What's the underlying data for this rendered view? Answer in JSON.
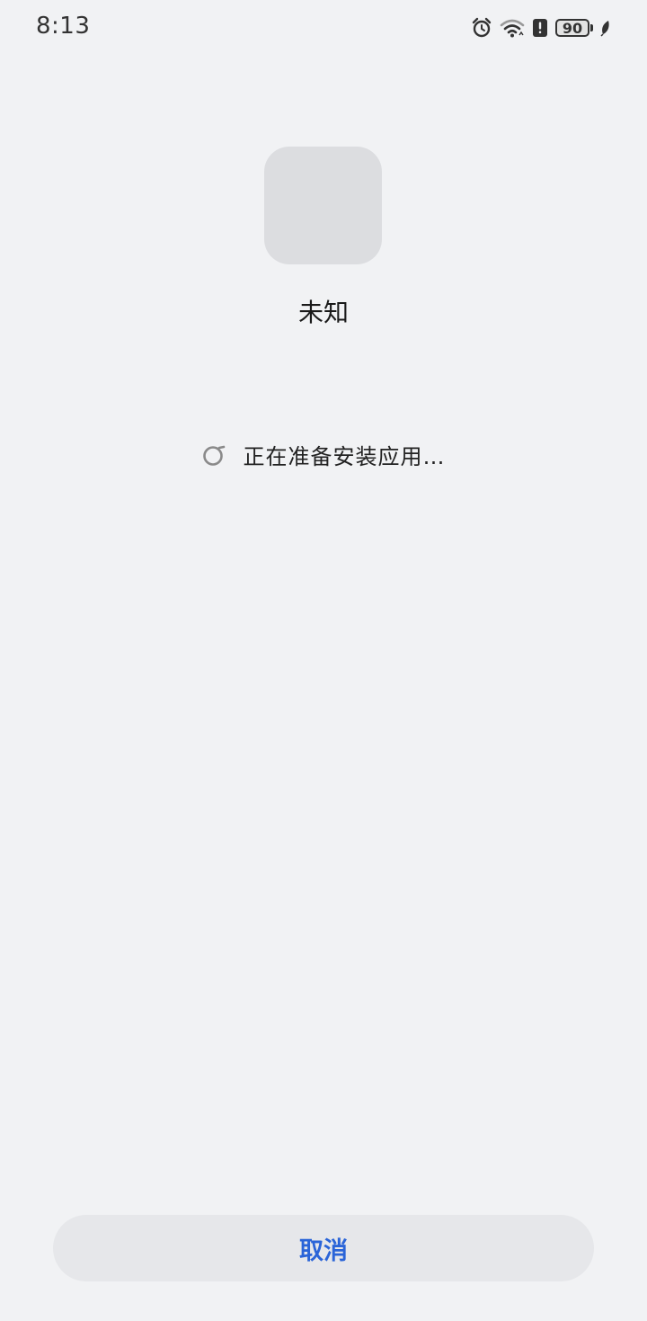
{
  "status_bar": {
    "time": "8:13",
    "icons": [
      "alarm-icon",
      "wifi-icon",
      "alert-icon",
      "battery-icon",
      "leaf-icon"
    ],
    "battery_level": "90"
  },
  "app": {
    "name": "未知",
    "icon": "app-placeholder-icon"
  },
  "progress": {
    "text": "正在准备安装应用…",
    "icon": "loading-spinner-icon"
  },
  "actions": {
    "cancel_label": "取消",
    "cancel_color": "#2a64d8"
  }
}
